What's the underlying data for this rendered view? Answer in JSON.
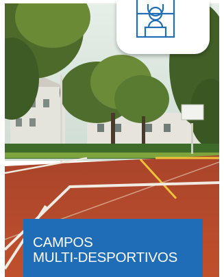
{
  "caption": {
    "line1": "CAMPOS",
    "line2": "MULTI-DESPORTIVOS"
  },
  "badge": {
    "icon": "basketball-court-icon"
  },
  "colors": {
    "caption_bg": "#1f6db6",
    "caption_text": "#ffffff",
    "court_surface": "#b84a2a",
    "court_lines": "#f1c33b",
    "icon_stroke": "#1f6db6"
  }
}
